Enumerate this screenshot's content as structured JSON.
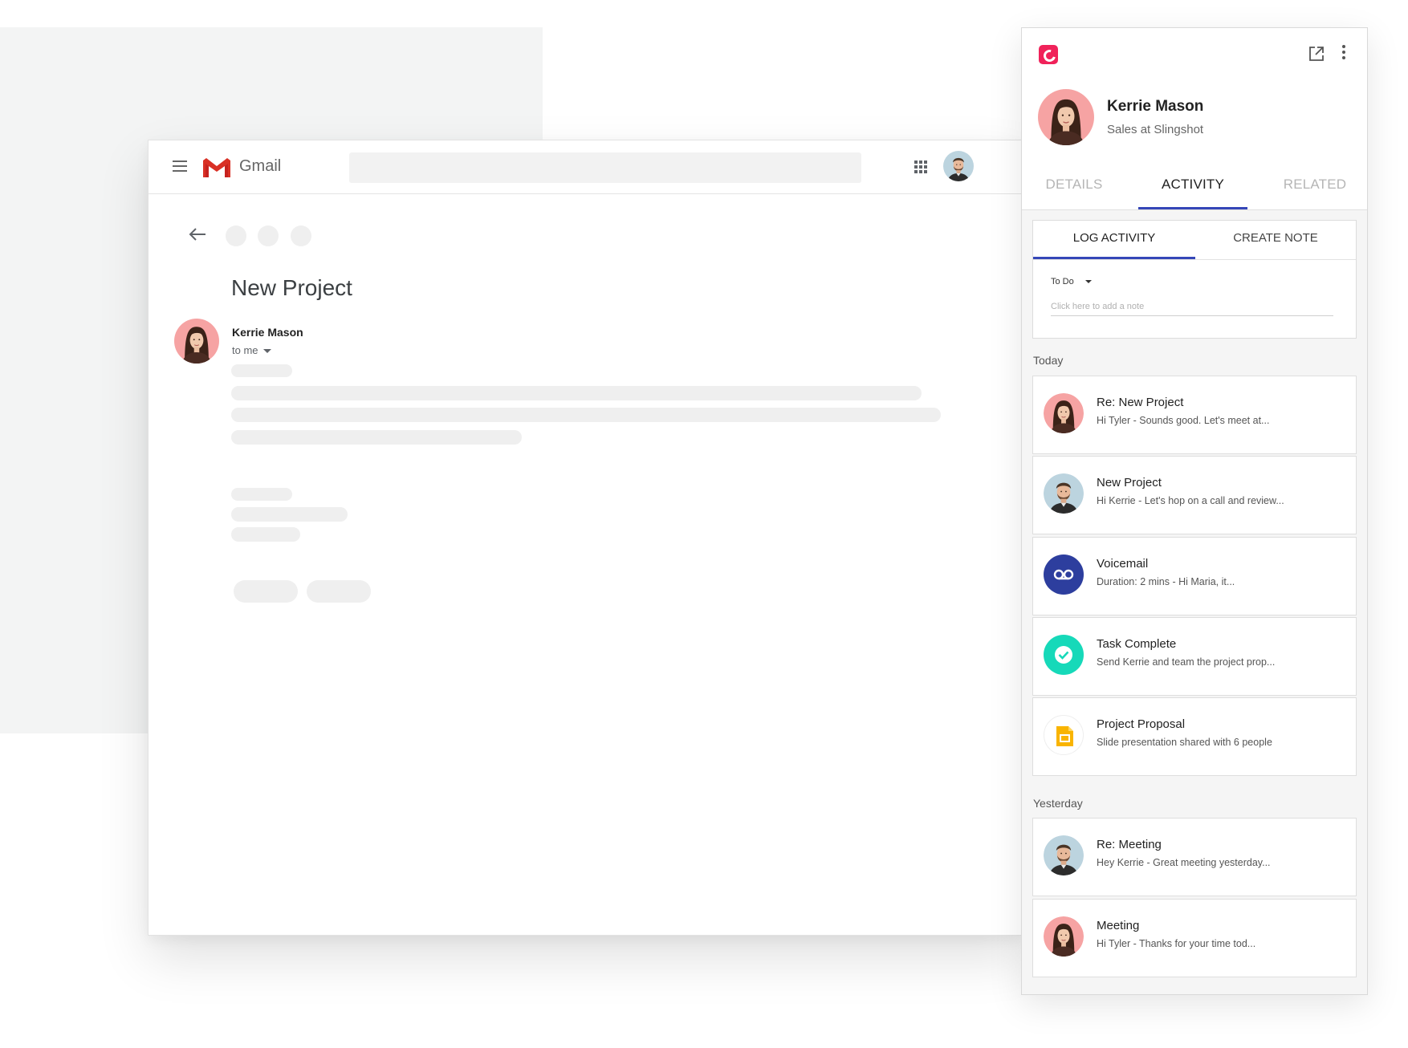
{
  "gmail": {
    "app_name": "Gmail",
    "search": {
      "placeholder": ""
    },
    "email": {
      "subject": "New Project",
      "sender": "Kerrie Mason",
      "recipient": "to me"
    }
  },
  "panel": {
    "contact": {
      "name": "Kerrie Mason",
      "role": "Sales at Slingshot"
    },
    "tabs": [
      "DETAILS",
      "ACTIVITY",
      "RELATED"
    ],
    "active_tab": "ACTIVITY",
    "log": {
      "tabs": [
        "LOG ACTIVITY",
        "CREATE NOTE"
      ],
      "status": "To Do",
      "note_placeholder": "Click here to add a note"
    },
    "sections": [
      {
        "label": "Today",
        "items": [
          {
            "title": "Re: New Project",
            "subtitle": "Hi Tyler -  Sounds good. Let's meet at...",
            "icon": "avatar-woman-icon"
          },
          {
            "title": "New Project",
            "subtitle": "Hi Kerrie - Let's hop on a call and review...",
            "icon": "avatar-man-icon"
          },
          {
            "title": "Voicemail",
            "subtitle": "Duration: 2 mins -  Hi Maria, it...",
            "icon": "voicemail-icon"
          },
          {
            "title": "Task Complete",
            "subtitle": "Send Kerrie and team the project prop...",
            "icon": "check-circle-icon"
          },
          {
            "title": "Project Proposal",
            "subtitle": "Slide presentation shared with 6 people",
            "icon": "slides-icon"
          }
        ]
      },
      {
        "label": "Yesterday",
        "items": [
          {
            "title": "Re: Meeting",
            "subtitle": "Hey Kerrie - Great meeting yesterday...",
            "icon": "avatar-man-icon"
          },
          {
            "title": "Meeting",
            "subtitle": "Hi Tyler - Thanks for your time tod...",
            "icon": "avatar-woman-icon"
          }
        ]
      }
    ]
  },
  "colors": {
    "accent": "#3546b8",
    "brand": "#f0225a",
    "voicemail": "#2d3e9e",
    "task": "#16d9b9",
    "slides": "#f9b400",
    "gmail_red": "#d93025"
  }
}
